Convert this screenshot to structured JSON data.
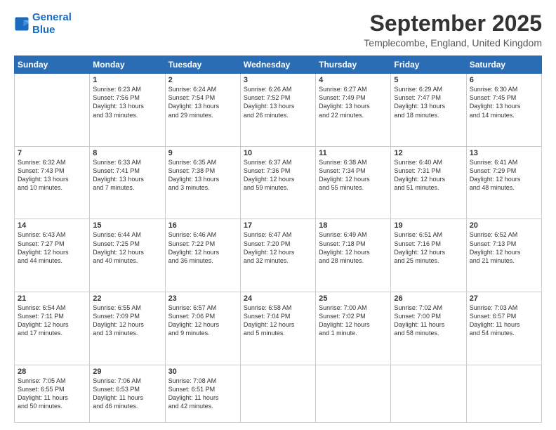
{
  "logo": {
    "line1": "General",
    "line2": "Blue"
  },
  "header": {
    "month": "September 2025",
    "location": "Templecombe, England, United Kingdom"
  },
  "weekdays": [
    "Sunday",
    "Monday",
    "Tuesday",
    "Wednesday",
    "Thursday",
    "Friday",
    "Saturday"
  ],
  "weeks": [
    [
      {
        "day": "",
        "info": ""
      },
      {
        "day": "1",
        "info": "Sunrise: 6:23 AM\nSunset: 7:56 PM\nDaylight: 13 hours\nand 33 minutes."
      },
      {
        "day": "2",
        "info": "Sunrise: 6:24 AM\nSunset: 7:54 PM\nDaylight: 13 hours\nand 29 minutes."
      },
      {
        "day": "3",
        "info": "Sunrise: 6:26 AM\nSunset: 7:52 PM\nDaylight: 13 hours\nand 26 minutes."
      },
      {
        "day": "4",
        "info": "Sunrise: 6:27 AM\nSunset: 7:49 PM\nDaylight: 13 hours\nand 22 minutes."
      },
      {
        "day": "5",
        "info": "Sunrise: 6:29 AM\nSunset: 7:47 PM\nDaylight: 13 hours\nand 18 minutes."
      },
      {
        "day": "6",
        "info": "Sunrise: 6:30 AM\nSunset: 7:45 PM\nDaylight: 13 hours\nand 14 minutes."
      }
    ],
    [
      {
        "day": "7",
        "info": "Sunrise: 6:32 AM\nSunset: 7:43 PM\nDaylight: 13 hours\nand 10 minutes."
      },
      {
        "day": "8",
        "info": "Sunrise: 6:33 AM\nSunset: 7:41 PM\nDaylight: 13 hours\nand 7 minutes."
      },
      {
        "day": "9",
        "info": "Sunrise: 6:35 AM\nSunset: 7:38 PM\nDaylight: 13 hours\nand 3 minutes."
      },
      {
        "day": "10",
        "info": "Sunrise: 6:37 AM\nSunset: 7:36 PM\nDaylight: 12 hours\nand 59 minutes."
      },
      {
        "day": "11",
        "info": "Sunrise: 6:38 AM\nSunset: 7:34 PM\nDaylight: 12 hours\nand 55 minutes."
      },
      {
        "day": "12",
        "info": "Sunrise: 6:40 AM\nSunset: 7:31 PM\nDaylight: 12 hours\nand 51 minutes."
      },
      {
        "day": "13",
        "info": "Sunrise: 6:41 AM\nSunset: 7:29 PM\nDaylight: 12 hours\nand 48 minutes."
      }
    ],
    [
      {
        "day": "14",
        "info": "Sunrise: 6:43 AM\nSunset: 7:27 PM\nDaylight: 12 hours\nand 44 minutes."
      },
      {
        "day": "15",
        "info": "Sunrise: 6:44 AM\nSunset: 7:25 PM\nDaylight: 12 hours\nand 40 minutes."
      },
      {
        "day": "16",
        "info": "Sunrise: 6:46 AM\nSunset: 7:22 PM\nDaylight: 12 hours\nand 36 minutes."
      },
      {
        "day": "17",
        "info": "Sunrise: 6:47 AM\nSunset: 7:20 PM\nDaylight: 12 hours\nand 32 minutes."
      },
      {
        "day": "18",
        "info": "Sunrise: 6:49 AM\nSunset: 7:18 PM\nDaylight: 12 hours\nand 28 minutes."
      },
      {
        "day": "19",
        "info": "Sunrise: 6:51 AM\nSunset: 7:16 PM\nDaylight: 12 hours\nand 25 minutes."
      },
      {
        "day": "20",
        "info": "Sunrise: 6:52 AM\nSunset: 7:13 PM\nDaylight: 12 hours\nand 21 minutes."
      }
    ],
    [
      {
        "day": "21",
        "info": "Sunrise: 6:54 AM\nSunset: 7:11 PM\nDaylight: 12 hours\nand 17 minutes."
      },
      {
        "day": "22",
        "info": "Sunrise: 6:55 AM\nSunset: 7:09 PM\nDaylight: 12 hours\nand 13 minutes."
      },
      {
        "day": "23",
        "info": "Sunrise: 6:57 AM\nSunset: 7:06 PM\nDaylight: 12 hours\nand 9 minutes."
      },
      {
        "day": "24",
        "info": "Sunrise: 6:58 AM\nSunset: 7:04 PM\nDaylight: 12 hours\nand 5 minutes."
      },
      {
        "day": "25",
        "info": "Sunrise: 7:00 AM\nSunset: 7:02 PM\nDaylight: 12 hours\nand 1 minute."
      },
      {
        "day": "26",
        "info": "Sunrise: 7:02 AM\nSunset: 7:00 PM\nDaylight: 11 hours\nand 58 minutes."
      },
      {
        "day": "27",
        "info": "Sunrise: 7:03 AM\nSunset: 6:57 PM\nDaylight: 11 hours\nand 54 minutes."
      }
    ],
    [
      {
        "day": "28",
        "info": "Sunrise: 7:05 AM\nSunset: 6:55 PM\nDaylight: 11 hours\nand 50 minutes."
      },
      {
        "day": "29",
        "info": "Sunrise: 7:06 AM\nSunset: 6:53 PM\nDaylight: 11 hours\nand 46 minutes."
      },
      {
        "day": "30",
        "info": "Sunrise: 7:08 AM\nSunset: 6:51 PM\nDaylight: 11 hours\nand 42 minutes."
      },
      {
        "day": "",
        "info": ""
      },
      {
        "day": "",
        "info": ""
      },
      {
        "day": "",
        "info": ""
      },
      {
        "day": "",
        "info": ""
      }
    ]
  ]
}
